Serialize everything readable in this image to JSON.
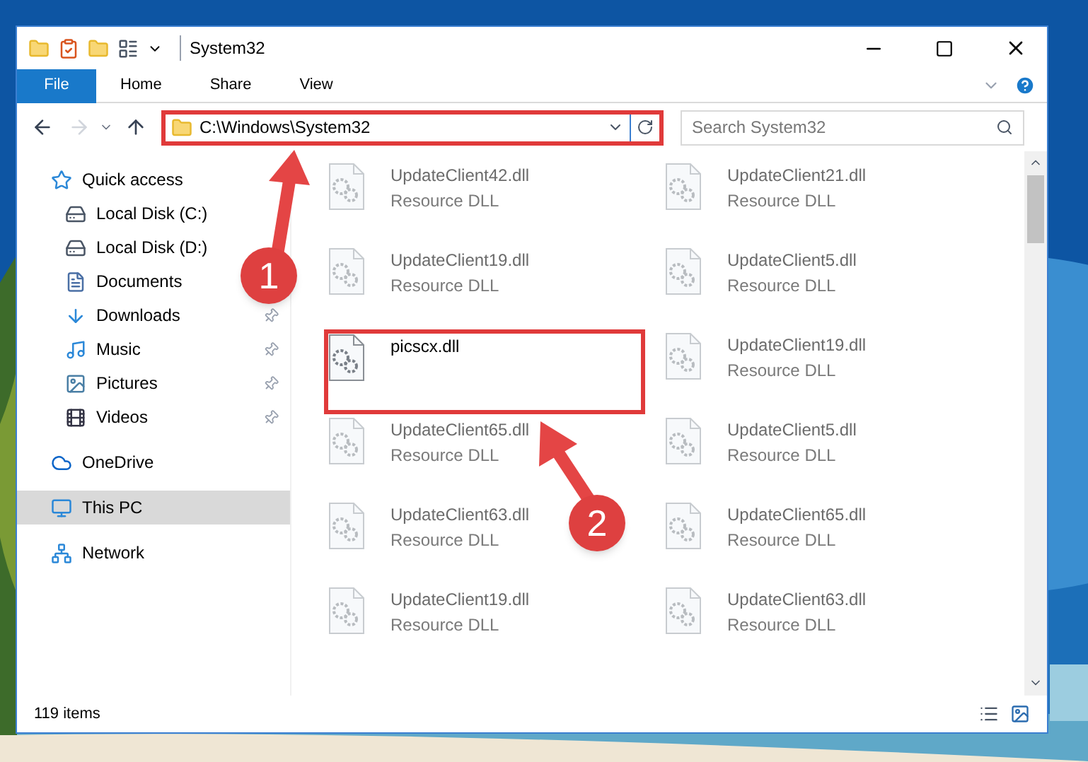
{
  "window": {
    "title": "System32",
    "tabs": [
      {
        "label": "File",
        "selected": true
      },
      {
        "label": "Home",
        "selected": false
      },
      {
        "label": "Share",
        "selected": false
      },
      {
        "label": "View",
        "selected": false
      }
    ]
  },
  "address": {
    "path": "C:\\Windows\\System32"
  },
  "search": {
    "placeholder": "Search System32"
  },
  "sidebar": {
    "items": [
      {
        "label": "Quick access",
        "kind": "star",
        "selected": false,
        "children": [
          {
            "label": "Local Disk (C:)",
            "kind": "disk",
            "pinned": false
          },
          {
            "label": "Local Disk (D:)",
            "kind": "disk",
            "pinned": false
          },
          {
            "label": "Documents",
            "kind": "document",
            "pinned": false
          },
          {
            "label": "Downloads",
            "kind": "download",
            "pinned": true
          },
          {
            "label": "Music",
            "kind": "music",
            "pinned": true
          },
          {
            "label": "Pictures",
            "kind": "pictures",
            "pinned": true
          },
          {
            "label": "Videos",
            "kind": "videos",
            "pinned": true
          }
        ]
      },
      {
        "label": "OneDrive",
        "kind": "cloud",
        "selected": false
      },
      {
        "label": "This PC",
        "kind": "pc",
        "selected": true
      },
      {
        "label": "Network",
        "kind": "network",
        "selected": false
      }
    ]
  },
  "files": [
    {
      "name": "UpdateClient42.dll",
      "type": "Resource DLL",
      "dimmed": true,
      "framed": false
    },
    {
      "name": "UpdateClient21.dll",
      "type": "Resource DLL",
      "dimmed": true,
      "framed": false
    },
    {
      "name": "UpdateClient19.dll",
      "type": "Resource DLL",
      "dimmed": true,
      "framed": false
    },
    {
      "name": "UpdateClient5.dll",
      "type": "Resource DLL",
      "dimmed": true,
      "framed": false
    },
    {
      "name": "picscx.dll",
      "dimmed": false,
      "framed": true
    },
    {
      "name": "UpdateClient19.dll",
      "type": "Resource DLL",
      "dimmed": true,
      "framed": false
    },
    {
      "name": "UpdateClient65.dll",
      "type": "Resource DLL",
      "dimmed": true,
      "framed": false
    },
    {
      "name": "UpdateClient5.dll",
      "type": "Resource DLL",
      "dimmed": true,
      "framed": false
    },
    {
      "name": "UpdateClient63.dll",
      "type": "Resource DLL",
      "dimmed": true,
      "framed": false
    },
    {
      "name": "UpdateClient65.dll",
      "type": "Resource DLL",
      "dimmed": true,
      "framed": false
    },
    {
      "name": "UpdateClient19.dll",
      "type": "Resource DLL",
      "dimmed": true,
      "framed": false
    },
    {
      "name": "UpdateClient63.dll",
      "type": "Resource DLL",
      "dimmed": true,
      "framed": false
    }
  ],
  "status_bar": {
    "count": "119 items"
  },
  "annotations": [
    {
      "label": "1"
    },
    {
      "label": "2"
    }
  ]
}
